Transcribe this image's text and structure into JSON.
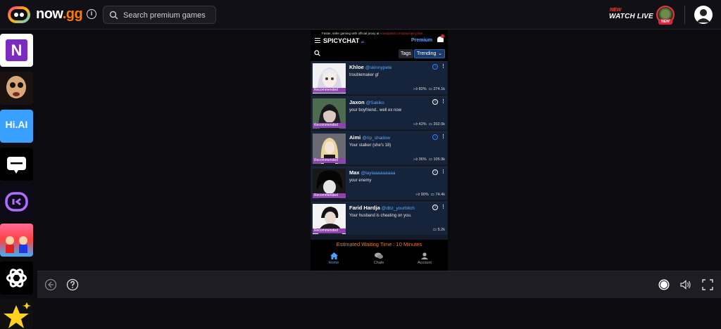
{
  "header": {
    "brand_name": "now",
    "brand_suffix": ".gg",
    "search_placeholder": "Search premium games",
    "watch_new": "NEW",
    "watch_live": "WATCH LIVE",
    "live_badge": "NEW"
  },
  "sidebar": {
    "apps": [
      {
        "name": "notion-app",
        "letter": "N"
      },
      {
        "name": "horror-doll-app"
      },
      {
        "name": "hi-ai-app",
        "label": "Hi.AI"
      },
      {
        "name": "chat-bubble-app"
      },
      {
        "name": "talkie-app"
      },
      {
        "name": "cartoon-game-app"
      },
      {
        "name": "chatgpt-app"
      },
      {
        "name": "star-app"
      }
    ]
  },
  "phone": {
    "proxy_text": "Faster, safer gaming with official proxy at ",
    "proxy_url": "nowaljabid.com/play/spicychat",
    "site_title": "SPICYCHAT",
    "site_title_suffix": "AI",
    "premium_label": "Premium",
    "tags_label": "Tags",
    "sort_label": "Trending",
    "cards": [
      {
        "name": "Khloe",
        "handle": "@skinnypete",
        "desc": "troublemaker gf",
        "like": "82%",
        "chats": "274.1k",
        "badge": "Recommended"
      },
      {
        "name": "Jaxon",
        "handle": "@Sakiko",
        "desc": "your boyfriend.. well ex now",
        "like": "42%",
        "chats": "202.0k",
        "badge": "Recommended"
      },
      {
        "name": "Aimi",
        "handle": "@rip_shadow",
        "desc": "Your stalker (she's 18)",
        "like": "36%",
        "chats": "105.9k",
        "badge": "Recommended"
      },
      {
        "name": "Max",
        "handle": "@laylaaaaaaaaa",
        "desc": "your enemy",
        "like": "90%",
        "chats": "74.4k",
        "badge": "Recommended"
      },
      {
        "name": "Farid Hardja",
        "handle": "@dbz_yourbitch",
        "desc": "Your husband is cheating on you.",
        "like": "",
        "chats": "5.2k",
        "badge": "Recommended"
      }
    ],
    "wait_text": "Estimated Waiting Time : 10 Minutes",
    "nav": {
      "home": "Home",
      "chats": "Chats",
      "account": "Account"
    }
  },
  "colors": {
    "accent_orange": "#ff7a00",
    "link_blue": "#5aa8ff",
    "badge_purple": "#8e44ad",
    "live_red": "#e0243a"
  }
}
